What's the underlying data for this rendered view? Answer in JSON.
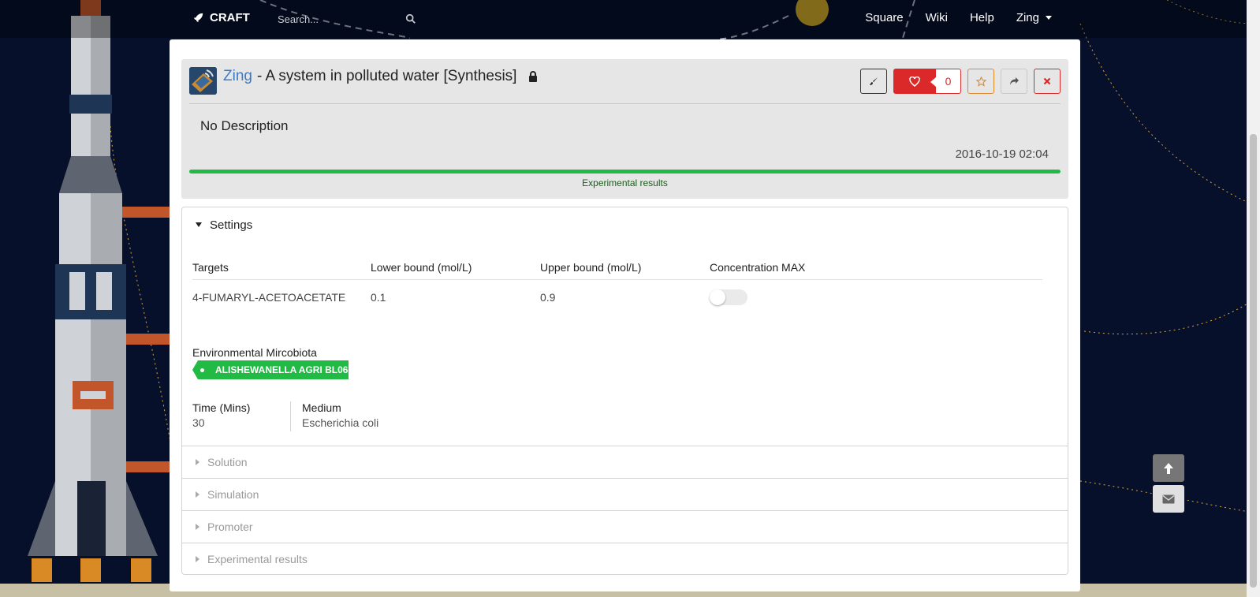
{
  "nav": {
    "brand": "CRAFT",
    "search_placeholder": "Search...",
    "links": [
      "Square",
      "Wiki",
      "Help"
    ],
    "user": "Zing"
  },
  "header": {
    "user": "Zing",
    "title": " - A system in polluted water [Synthesis]",
    "like_count": "0",
    "description": "No Description",
    "timestamp": "2016-10-19 02:04",
    "progress_percent": 100,
    "progress_label": "Experimental results"
  },
  "settings": {
    "title": "Settings",
    "columns": [
      "Targets",
      "Lower bound (mol/L)",
      "Upper bound (mol/L)",
      "Concentration MAX"
    ],
    "rows": [
      {
        "target": "4-FUMARYL-ACETOACETATE",
        "lower": "0.1",
        "upper": "0.9",
        "max_on": false
      }
    ],
    "env_label": "Environmental Mircobiota",
    "env_tag": "ALISHEWANELLA AGRI BL06",
    "time_label": "Time (Mins)",
    "time_value": "30",
    "medium_label": "Medium",
    "medium_value": "Escherichia coli"
  },
  "sections": [
    "Solution",
    "Simulation",
    "Promoter",
    "Experimental results"
  ],
  "colors": {
    "accent_blue": "#3a7bc8",
    "like_red": "#db2828",
    "success_green": "#21ba45",
    "star_orange": "#e08a2c"
  },
  "icons": [
    "rocket-icon",
    "search-icon",
    "caret-down-icon",
    "lock-icon",
    "paint-brush-icon",
    "heart-icon",
    "star-icon",
    "share-icon",
    "close-icon",
    "arrow-up-icon",
    "mail-icon"
  ]
}
